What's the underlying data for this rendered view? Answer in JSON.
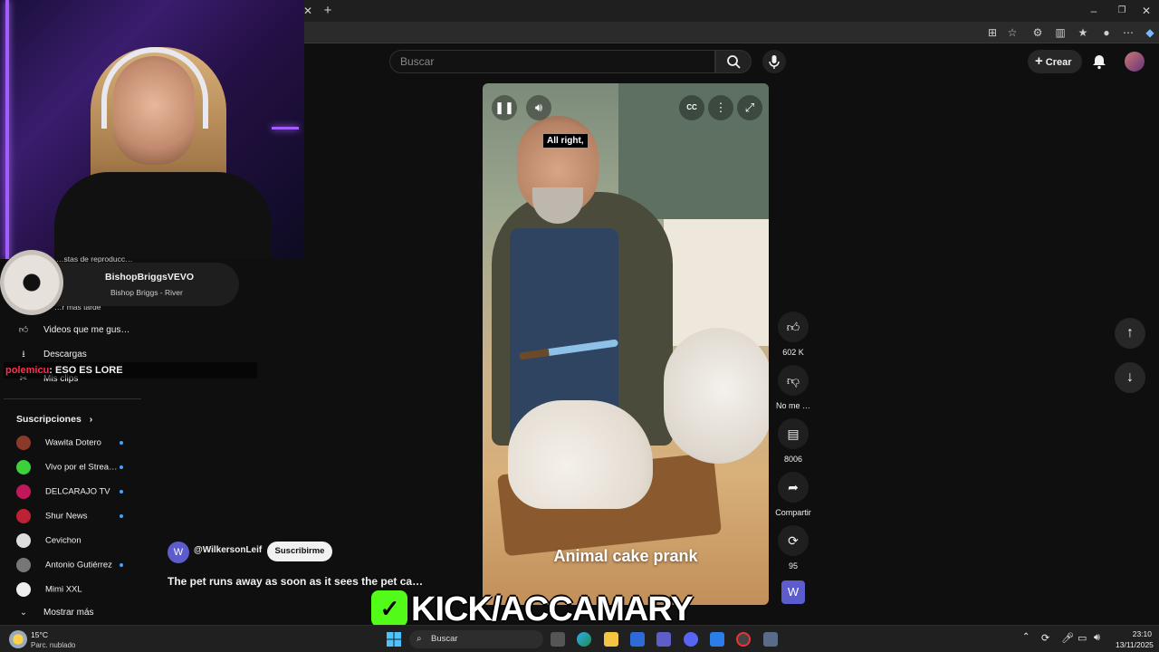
{
  "search": {
    "placeholder": "Buscar"
  },
  "header": {
    "create_label": "Crear"
  },
  "sidebar": {
    "items": [
      {
        "label": "…stas de reproducc…"
      },
      {
        "label": "…r más tarde"
      },
      {
        "label": "Videos que me gus…"
      },
      {
        "label": "Descargas"
      },
      {
        "label": "Mis clips"
      }
    ],
    "subscriptions_title": "Suscripciones",
    "subscriptions": [
      {
        "name": "Wawita Dotero",
        "color": "#8b3a2a",
        "dot": true
      },
      {
        "name": "Vivo por el Strea…",
        "color": "#3ad13a",
        "dot": true
      },
      {
        "name": "DELCARAJO TV",
        "color": "#c2185b",
        "dot": true
      },
      {
        "name": "Shur News",
        "color": "#b23",
        "dot": true
      },
      {
        "name": "Cevichon",
        "color": "#ddd",
        "dot": false
      },
      {
        "name": "Antonio Gutiérrez",
        "color": "#777",
        "dot": true
      },
      {
        "name": "Mimi XXL",
        "color": "#eee",
        "dot": false
      }
    ],
    "show_more": "Mostrar más"
  },
  "music_card": {
    "channel": "BishopBriggsVEVO",
    "track": "Bishop Briggs - River"
  },
  "chat": {
    "user": "polemicu",
    "message": ": ESO ES LORE"
  },
  "video": {
    "caption": "All right,",
    "overlay_text": "Animal cake prank"
  },
  "actions": {
    "likes": "602 K",
    "dislike_label": "No me …",
    "comments": "8006",
    "share_label": "Compartir",
    "remix_count": "95"
  },
  "channel": {
    "avatar_letter": "W",
    "name": "@WilkersonLeif",
    "subscribe_label": "Suscribirme"
  },
  "video_title": "The pet runs away as soon as it sees the pet ca…",
  "branding": {
    "text": "KICK/ACCAMARY"
  },
  "taskbar": {
    "weather_temp": "15°C",
    "weather_desc": "Parc. nublado",
    "search_label": "Buscar",
    "time": "23:10",
    "date": "13/11/2025"
  },
  "colors": {
    "kick_green": "#53fc18",
    "subscription_dot": "#3ea6ff"
  }
}
